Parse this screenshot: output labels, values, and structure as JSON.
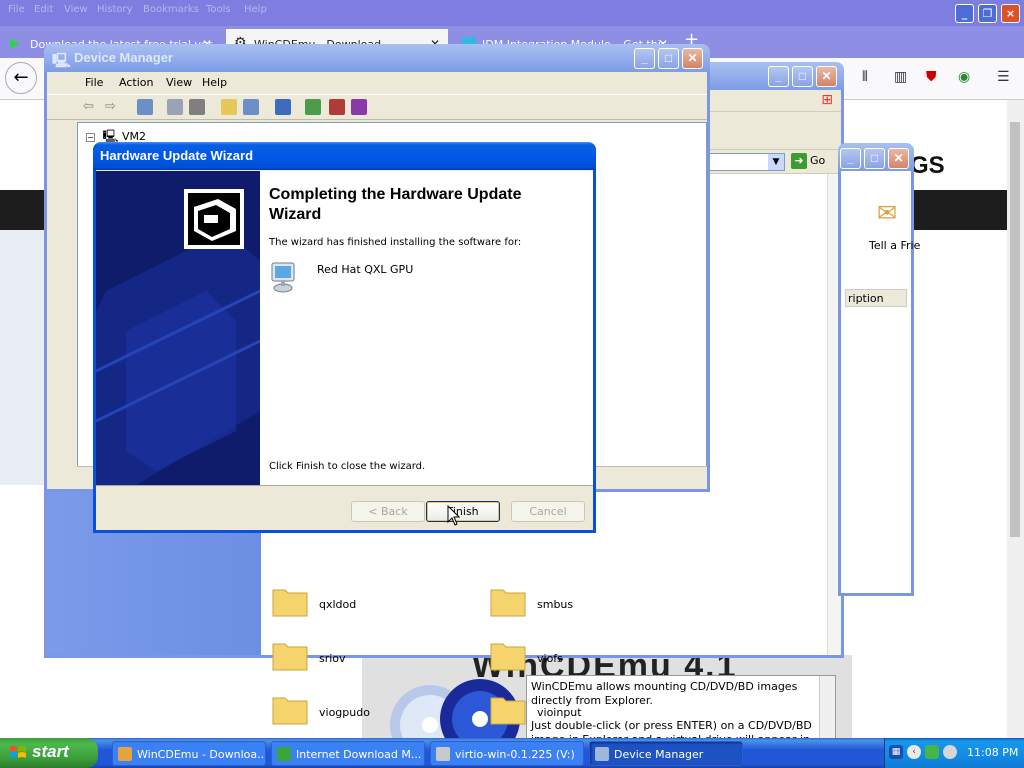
{
  "firefox": {
    "menu": [
      "File",
      "Edit",
      "View",
      "History",
      "Bookmarks",
      "Tools",
      "Help"
    ],
    "tabs": [
      {
        "label": "Download the latest free trial ver"
      },
      {
        "label": "WinCDEmu - Download"
      },
      {
        "label": "IDM Integration Module – Get this"
      }
    ],
    "page_heading_fragment": "GS",
    "banner_title": "WinCDEmu 4.1",
    "page_text": [
      "WinCDEmu allows mounting CD/DVD/BD images directly from Explorer.",
      "Just double-click (or press ENTER) on a CD/DVD/BD image in Explorer and a virtual drive will appear in your system."
    ]
  },
  "explorer": {
    "address_go": "Go",
    "folders": [
      {
        "name": "qxldod"
      },
      {
        "name": "smbus"
      },
      {
        "name": "sriov"
      },
      {
        "name": "viofs"
      },
      {
        "name": "viogpudo"
      },
      {
        "name": "vioinput"
      }
    ]
  },
  "idm": {
    "toolbar_label": "Tell a Frie",
    "column_header": "ription"
  },
  "device_manager": {
    "title": "Device Manager",
    "menu": [
      {
        "label": "File"
      },
      {
        "label": "Action"
      },
      {
        "label": "View"
      },
      {
        "label": "Help"
      }
    ],
    "tree_root": "VM2"
  },
  "wizard": {
    "title": "Hardware Update Wizard",
    "heading": "Completing the Hardware Update Wizard",
    "subtitle": "The wizard has finished installing the software for:",
    "device_name": "Red Hat QXL GPU",
    "close_hint": "Click Finish to close the wizard.",
    "buttons": {
      "back": "< Back",
      "finish": "Finish",
      "cancel": "Cancel"
    }
  },
  "taskbar": {
    "start_label": "start",
    "tasks": [
      {
        "label": "WinCDEmu - Downloa..."
      },
      {
        "label": "Internet Download M..."
      },
      {
        "label": "virtio-win-0.1.225 (V:)"
      },
      {
        "label": "Device Manager"
      }
    ],
    "clock": "11:08 PM"
  },
  "colors": {
    "xp_title_blue": "#0058e6",
    "wizard_sidebar": "#0e1c6b",
    "start_green": "#3a9d3a",
    "taskbar_blue": "#2157d7"
  }
}
